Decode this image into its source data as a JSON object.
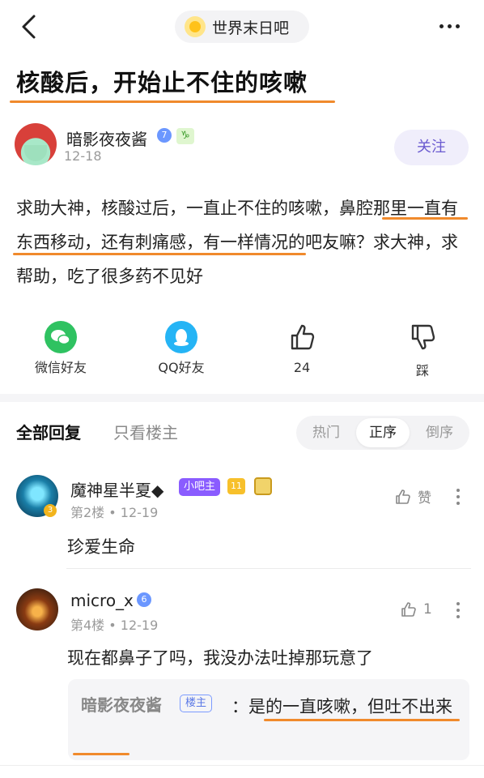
{
  "nav": {
    "forum_name": "世界末日吧"
  },
  "post": {
    "title": "核酸后，开始止不住的咳嗽",
    "author": "暗影夜夜酱",
    "author_level_badge": "7",
    "author_zodiac": "♑",
    "date": "12-18",
    "follow_label": "关注",
    "body": "求助大神，核酸过后，一直止不住的咳嗽，鼻腔那里一直有东西移动，还有刺痛感，有一样情况的吧友嘛？求大神，求帮助，吃了很多药不见好"
  },
  "actions": {
    "wechat_label": "微信好友",
    "qq_label": "QQ好友",
    "like_count": "24",
    "dislike_label": "踩"
  },
  "reply_tabs": {
    "all": "全部回复",
    "owner_only": "只看楼主",
    "sort_hot": "热门",
    "sort_asc": "正序",
    "sort_desc": "倒序"
  },
  "replies": [
    {
      "name": "魔神星半夏◆",
      "tag": "小吧主",
      "level": "11",
      "avatar_level": "3",
      "floor": "第2楼",
      "date": "12-19",
      "like_label": "赞",
      "content": "珍爱生命"
    },
    {
      "name": "micro_x",
      "badge": "6",
      "floor": "第4楼",
      "date": "12-19",
      "like_label": "1",
      "content": "现在都鼻子了吗，我没办法吐掉那玩意了",
      "sub_reply": {
        "name": "暗影夜夜酱",
        "tag": "楼主",
        "text": "：是的一直咳嗽，但吐不出来"
      }
    }
  ],
  "colors": {
    "highlight_underline": "#f08a2c",
    "follow_text": "#6a5ad0",
    "admin_tag": "#8a5cff"
  }
}
